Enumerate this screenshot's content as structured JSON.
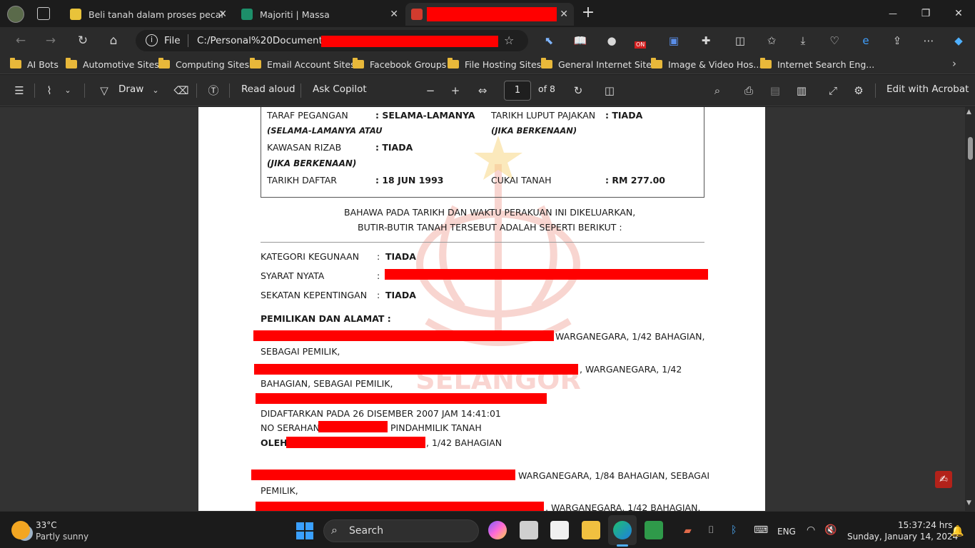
{
  "tabs": [
    {
      "title": "Beli tanah dalam proses pecah lo",
      "close": "✕"
    },
    {
      "title": "Majoriti | Massa",
      "close": "✕"
    },
    {
      "title": "",
      "close": "✕"
    }
  ],
  "window": {
    "new_tab": "+",
    "minimize": "—",
    "maximize": "❐",
    "close": "✕"
  },
  "address": {
    "scheme_label": "File",
    "url": "C:/Personal%20Documents/",
    "ext_badge": "ON"
  },
  "favorites": [
    {
      "label": "AI Bots"
    },
    {
      "label": "Automotive Sites"
    },
    {
      "label": "Computing Sites"
    },
    {
      "label": "Email Account Sites"
    },
    {
      "label": "Facebook Groups"
    },
    {
      "label": "File Hosting Sites"
    },
    {
      "label": "General Internet Sites"
    },
    {
      "label": "Image & Video Hos..."
    },
    {
      "label": "Internet Search Eng..."
    }
  ],
  "pdf_toolbar": {
    "draw": "Draw",
    "read_aloud": "Read aloud",
    "ask_copilot": "Ask Copilot",
    "page_current": "1",
    "page_total": "of 8",
    "edit_acrobat": "Edit with Acrobat"
  },
  "document": {
    "taraf_label": "TARAF PEGANGAN",
    "taraf_sub": "(SELAMA-LAMANYA ATAU",
    "taraf_value": ": SELAMA-LAMANYA",
    "luput_label": "TARIKH LUPUT PAJAKAN",
    "luput_sub": "(JIKA BERKENAAN)",
    "luput_value": ": TIADA",
    "rizab_label": "KAWASAN RIZAB",
    "rizab_sub": "(JIKA BERKENAAN)",
    "rizab_value": ": TIADA",
    "daftar_label": "TARIKH DAFTAR",
    "daftar_value": ": 18 JUN 1993",
    "cukai_label": "CUKAI TANAH",
    "cukai_value": ": RM 277.00",
    "intro_line1": "BAHAWA PADA TARIKH DAN WAKTU PERAKUAN INI DIKELUARKAN,",
    "intro_line2": "BUTIR-BUTIR TANAH TERSEBUT ADALAH SEPERTI BERIKUT :",
    "kategori_label": "KATEGORI KEGUNAAN",
    "kategori_colon": ":",
    "kategori_value": "TIADA",
    "syarat_label": "SYARAT NYATA",
    "syarat_colon": ":",
    "sekatan_label": "SEKATAN KEPENTINGAN",
    "sekatan_colon": ":",
    "sekatan_value": "TIADA",
    "pemilikan_heading": "PEMILIKAN DAN ALAMAT :",
    "owner1_tail": "WARGANEGARA, 1/42 BAHAGIAN,",
    "owner1_line2": "SEBAGAI PEMILIK,",
    "owner2_tail": ", WARGANEGARA, 1/42",
    "owner2_line2": "BAHAGIAN, SEBAGAI PEMILIK,",
    "didaftarkan": "DIDAFTARKAN PADA 26 DISEMBER 2007 JAM 14:41:01",
    "no_serahan": "NO SERAHAN",
    "pindahmilik": "PINDAHMILIK TANAH",
    "oleh": "OLEH",
    "oleh_tail": ", 1/42 BAHAGIAN",
    "owner3_tail": "WARGANEGARA, 1/84 BAHAGIAN, SEBAGAI",
    "owner3_line2": "PEMILIK,",
    "owner4_tail": ", WARGANEGARA, 1/42 BAHAGIAN,",
    "watermark": "SELANGOR"
  },
  "taskbar": {
    "temp": "33°C",
    "weather": "Partly sunny",
    "search": "Search",
    "lang": "ENG",
    "time": "15:37:24 hrs",
    "date": "Sunday, January 14, 2024"
  },
  "colors": {
    "redaction": "#ff0000",
    "watermark": "#f2a39a",
    "accent": "#0078d4"
  }
}
